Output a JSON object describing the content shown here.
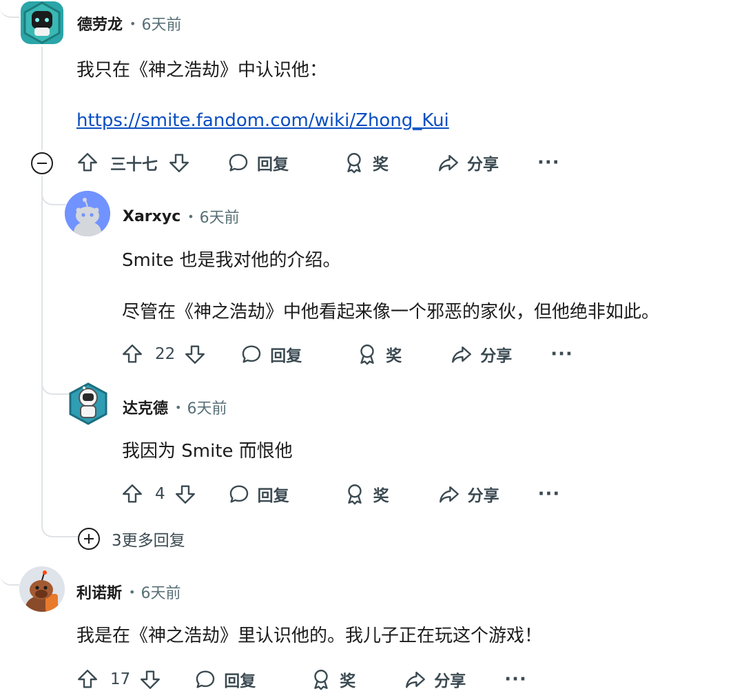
{
  "comments": [
    {
      "author": "德劳龙",
      "time": "6天前",
      "paragraphs": [
        "我只在《神之浩劫》中认识他："
      ],
      "link": "https://smite.fandom.com/wiki/Zhong_Kui",
      "votes": "三十七",
      "reply_label": "回复",
      "award_label": "奖",
      "share_label": "分享",
      "more_label": "···"
    },
    {
      "author": "Xarxyc",
      "time": "6天前",
      "paragraphs": [
        "Smite 也是我对他的介绍。",
        "尽管在《神之浩劫》中他看起来像一个邪恶的家伙，但他绝非如此。"
      ],
      "votes": "22",
      "reply_label": "回复",
      "award_label": "奖",
      "share_label": "分享",
      "more_label": "···"
    },
    {
      "author": "达克德",
      "time": "6天前",
      "paragraphs": [
        "我因为 Smite 而恨他"
      ],
      "votes": "4",
      "reply_label": "回复",
      "award_label": "奖",
      "share_label": "分享",
      "more_label": "···"
    },
    {
      "author": "利诺斯",
      "time": "6天前",
      "paragraphs": [
        "我是在《神之浩劫》里认识他的。我儿子正在玩这个游戏！"
      ],
      "votes": "17",
      "reply_label": "回复",
      "award_label": "奖",
      "share_label": "分享",
      "more_label": "···"
    }
  ],
  "more_replies_label": "3更多回复",
  "icons": [
    "upvote-icon",
    "downvote-icon",
    "comment-icon",
    "award-icon",
    "share-icon",
    "collapse-icon",
    "expand-icon"
  ],
  "colors": {
    "text": "#1c1c1c",
    "meta": "#576f76",
    "link": "#0a4ec2",
    "thread": "#e0e3e6",
    "action": "#3b4a52"
  }
}
